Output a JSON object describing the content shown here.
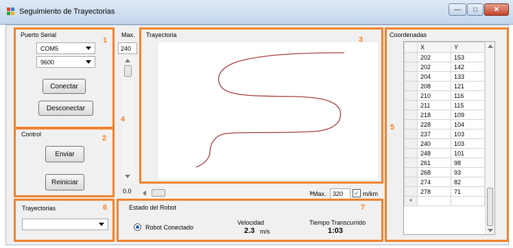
{
  "window": {
    "title": "Seguimiento de Trayectorias"
  },
  "serial": {
    "label": "Puerto Serial",
    "number": "1",
    "port": "COM5",
    "baud": "9600",
    "connect_label": "Conectar",
    "disconnect_label": "Desconectar"
  },
  "control": {
    "label": "Control",
    "number": "2",
    "send_label": "Enviar",
    "reset_label": "Reiniciar"
  },
  "scale": {
    "max_label": "Max.",
    "max_value": "240",
    "min_value": "0.0",
    "number": "4"
  },
  "trajectory": {
    "label": "Trayectoria",
    "number": "3"
  },
  "hscroll": {
    "max_label": "Max.",
    "max_value": "320",
    "unit_label": "m/km",
    "unit_checked": true
  },
  "coordinates": {
    "label": "Coordenadas",
    "number": "5",
    "columns": [
      "X",
      "Y"
    ],
    "rows": [
      [
        "202",
        "153"
      ],
      [
        "202",
        "142"
      ],
      [
        "204",
        "133"
      ],
      [
        "208",
        "121"
      ],
      [
        "210",
        "116"
      ],
      [
        "211",
        "115"
      ],
      [
        "218",
        "109"
      ],
      [
        "228",
        "104"
      ],
      [
        "237",
        "103"
      ],
      [
        "240",
        "103"
      ],
      [
        "248",
        "101"
      ],
      [
        "261",
        "98"
      ],
      [
        "268",
        "93"
      ],
      [
        "274",
        "82"
      ],
      [
        "278",
        "71"
      ]
    ],
    "new_row_marker": "*"
  },
  "trajectories": {
    "label": "Trayectorias",
    "number": "6",
    "selected": ""
  },
  "robot_status": {
    "label": "Estado del Robot",
    "number": "7",
    "connected_label": "Robot Conectado",
    "speed_label": "Velocidad",
    "speed_value": "2.3",
    "speed_unit": "m/s",
    "time_label": "Tiempo Transcurrido",
    "time_value": "1:03"
  }
}
